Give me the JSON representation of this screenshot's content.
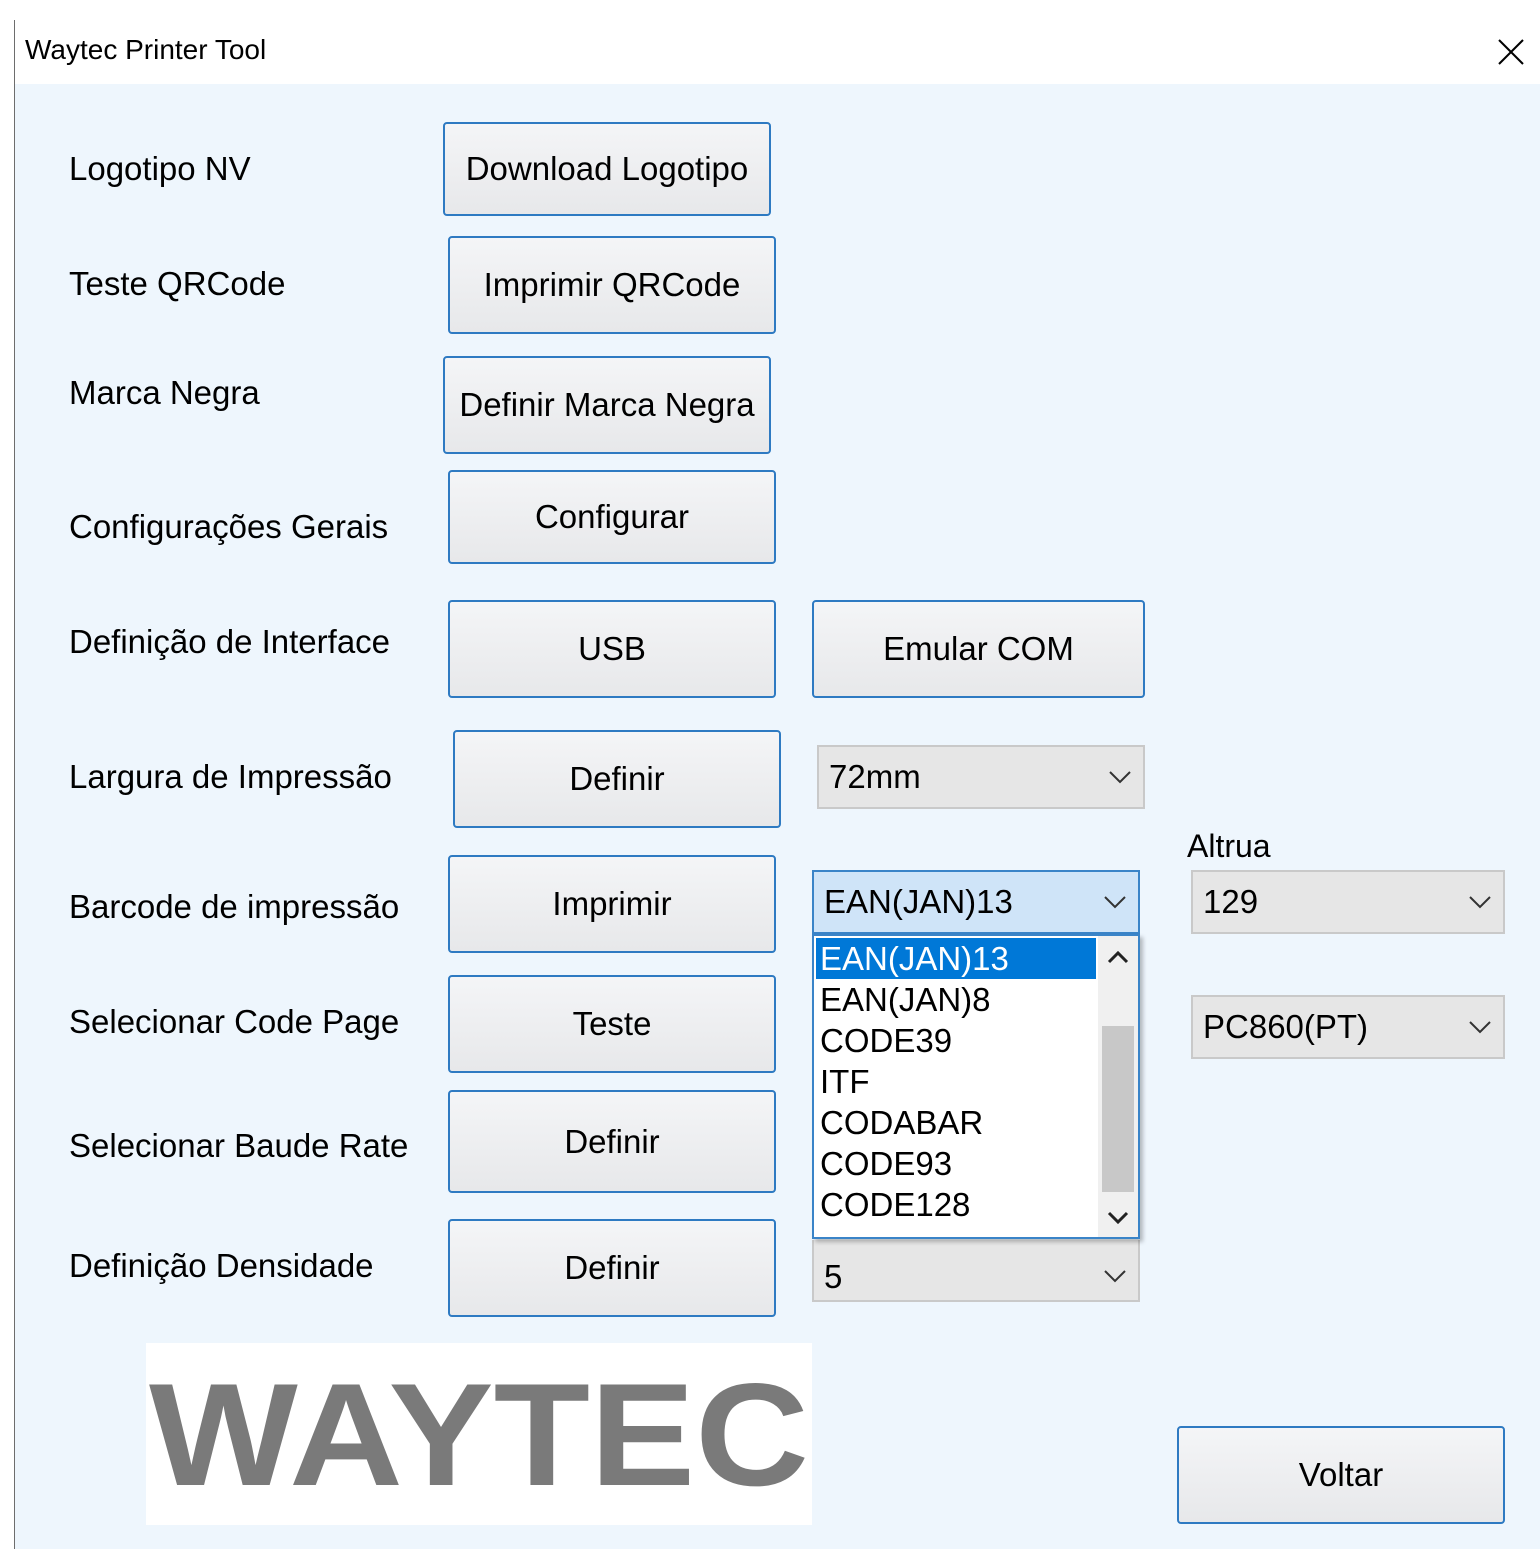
{
  "window": {
    "title": "Waytec Printer Tool"
  },
  "rows": {
    "logo_label": "Logotipo NV",
    "logo_button": "Download Logotipo",
    "qr_label": "Teste QRCode",
    "qr_button": "Imprimir QRCode",
    "mark_label": "Marca Negra",
    "mark_button": "Definir Marca Negra",
    "general_label": "Configurações Gerais",
    "general_button": "Configurar",
    "interface_label": "Definição de Interface",
    "usb_button": "USB",
    "com_button": "Emular COM",
    "width_label": "Largura de Impressão",
    "width_button": "Definir",
    "width_value": "72mm",
    "barcode_label": "Barcode de impressão",
    "barcode_button": "Imprimir",
    "barcode_value": "EAN(JAN)13",
    "height_label": "Altrua",
    "height_value": "129",
    "codepage_label": "Selecionar Code Page",
    "codepage_button": "Teste",
    "codepage_value": "PC860(PT)",
    "baud_label": "Selecionar Baude Rate",
    "baud_button": "Definir",
    "density_label": "Definição Densidade",
    "density_button": "Definir",
    "density_value": "5"
  },
  "barcode_dropdown": {
    "options": [
      "EAN(JAN)13",
      "EAN(JAN)8",
      "CODE39",
      "ITF",
      "CODABAR",
      "CODE93",
      "CODE128"
    ],
    "selected_index": 0
  },
  "logo": {
    "text": "WAYTEC"
  },
  "footer": {
    "back_button": "Voltar"
  },
  "icons": {
    "close": "close-icon",
    "chevron": "chevron-down-icon"
  },
  "colors": {
    "accent": "#0078d7",
    "button_border": "#2e7ac2",
    "window_bg": "#eef6fd",
    "logo_gray": "#7a7a7a"
  }
}
